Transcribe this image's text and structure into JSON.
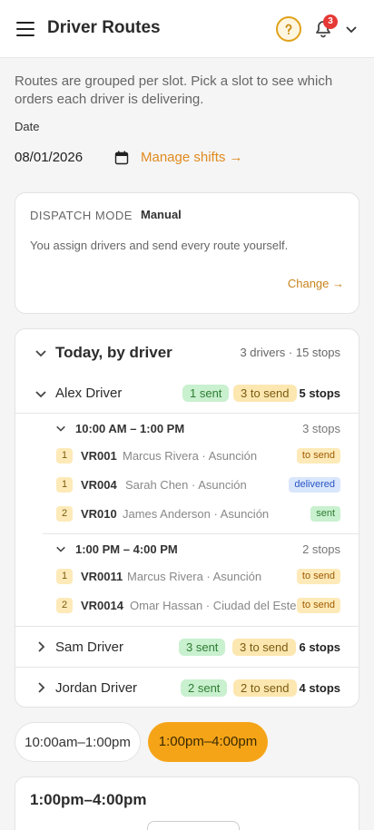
{
  "header": {
    "title": "Driver Routes",
    "notification_count": "3",
    "icons": [
      "menu-icon",
      "help-icon",
      "bell-icon",
      "chevron-down-icon"
    ],
    "accent_color": "#e0a21b"
  },
  "intro": "Routes are grouped per slot. Pick a slot to see which orders each driver is delivering.",
  "date": {
    "label": "Date",
    "value": "08/01/2026",
    "manage_link": "Manage shifts →"
  },
  "dispatch": {
    "label": "DISPATCH MODE",
    "mode": "Manual",
    "description": "You assign drivers and send every route yourself.",
    "change_link": "Change →"
  },
  "today": {
    "title": "Today, by driver",
    "meta": "3 drivers · 15 stops",
    "drivers": [
      {
        "name": "Alex Driver",
        "sent": "1 sent",
        "to_send": "3 to send",
        "stops": "5 stops",
        "slots": [
          {
            "time": "10:00 AM – 1:00 PM",
            "stops": "3 stops",
            "orders": [
              {
                "seq": "1",
                "id": "VR001",
                "customer": "Marcus Rivera · Asunción",
                "status": "to send"
              },
              {
                "seq": "1",
                "id": "VR004",
                "customer": "Sarah Chen · Asunción",
                "status": "delivered"
              },
              {
                "seq": "2",
                "id": "VR010",
                "customer": "James Anderson · Asunción",
                "status": "sent"
              }
            ]
          },
          {
            "time": "1:00 PM – 4:00 PM",
            "stops": "2 stops",
            "orders": [
              {
                "seq": "1",
                "id": "VR0011",
                "customer": "Marcus Rivera · Asunción",
                "status": "to send"
              },
              {
                "seq": "2",
                "id": "VR0014",
                "customer": "Omar Hassan · Ciudad del Este",
                "status": "to send"
              }
            ]
          }
        ]
      },
      {
        "name": "Sam Driver",
        "sent": "3 sent",
        "to_send": "3 to send",
        "stops": "6 stops"
      },
      {
        "name": "Jordan Driver",
        "sent": "2 sent",
        "to_send": "2 to send",
        "stops": "4 stops"
      }
    ]
  },
  "slot_tabs": [
    "10:00am–1:00pm",
    "1:00pm–4:00pm"
  ],
  "selected_slot": {
    "title": "1:00pm–4:00pm"
  }
}
